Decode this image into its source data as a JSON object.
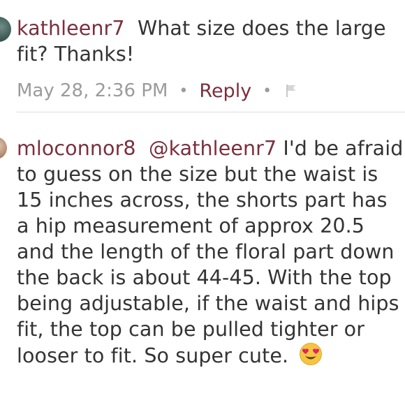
{
  "comments": [
    {
      "username": "kathleenr7",
      "text": "What size does the large fit? Thanks!",
      "timestamp": "May 28, 2:36 PM",
      "reply_label": "Reply"
    },
    {
      "username": "mloconnor8",
      "mention": "@kathleenr7",
      "text": "I'd be afraid to guess on the size but the waist is 15 inches across, the shorts part has a hip measurement of approx 20.5 and the length of the floral part down the back is about 44-45. With the top being adjustable, if the waist and hips fit, the top can be pulled tighter or looser to fit. So super cute."
    }
  ],
  "meta": {
    "separator": "•"
  },
  "icons": {
    "flag": "flag-icon",
    "emoji": "heart-eyes-emoji-icon",
    "avatar": "user-avatar"
  }
}
